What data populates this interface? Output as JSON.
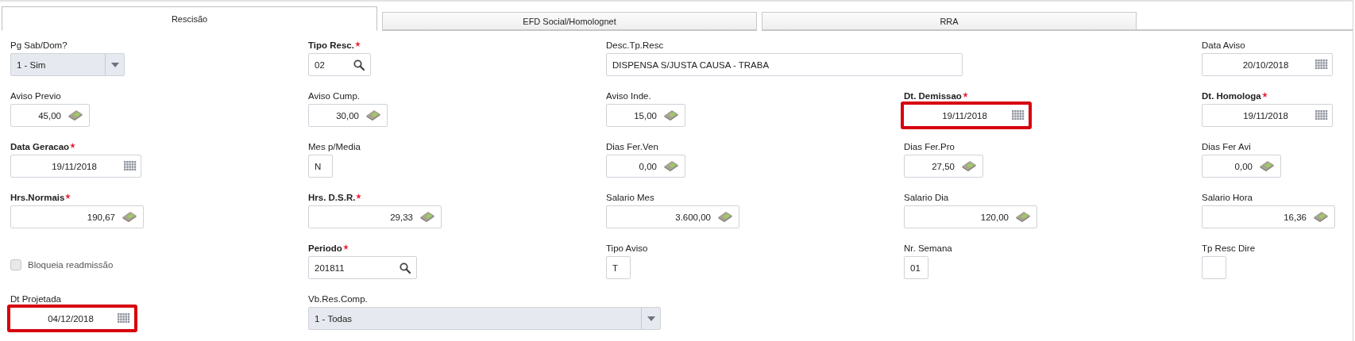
{
  "tabs": [
    {
      "label": "Rescisão",
      "selected": true
    },
    {
      "label": "EFD Social/Homolognet",
      "selected": false
    },
    {
      "label": "RRA",
      "selected": false
    }
  ],
  "rows": [
    [
      {
        "kind": "select",
        "label": "Pg Sab/Dom?",
        "required": false,
        "highlighted": false,
        "value": "1 - Sim"
      },
      {
        "kind": "lookup",
        "label": "Tipo Resc.",
        "required": true,
        "highlighted": false,
        "value": "02"
      },
      {
        "kind": "desc",
        "label": "Desc.Tp.Resc",
        "required": false,
        "highlighted": false,
        "value": "DISPENSA S/JUSTA CAUSA - TRABA"
      },
      {
        "kind": "date",
        "label": "Data Aviso",
        "required": false,
        "highlighted": false,
        "value": "20/10/2018"
      }
    ],
    [
      {
        "kind": "money",
        "label": "Aviso Previo",
        "required": false,
        "highlighted": false,
        "value": "45,00"
      },
      {
        "kind": "money",
        "label": "Aviso Cump.",
        "required": false,
        "highlighted": false,
        "value": "30,00"
      },
      {
        "kind": "money",
        "label": "Aviso Inde.",
        "required": false,
        "highlighted": false,
        "value": "15,00"
      },
      {
        "kind": "date",
        "label": "Dt. Demissao",
        "required": true,
        "highlighted": true,
        "value": "19/11/2018"
      },
      {
        "kind": "date",
        "label": "Dt. Homologa",
        "required": true,
        "highlighted": false,
        "value": "19/11/2018"
      }
    ],
    [
      {
        "kind": "date",
        "label": "Data Geracao",
        "required": true,
        "highlighted": false,
        "value": "19/11/2018"
      },
      {
        "kind": "char",
        "label": "Mes p/Media",
        "required": false,
        "highlighted": false,
        "value": "N"
      },
      {
        "kind": "money",
        "label": "Dias Fer.Ven",
        "required": false,
        "highlighted": false,
        "value": "0,00"
      },
      {
        "kind": "money",
        "label": "Dias Fer.Pro",
        "required": false,
        "highlighted": false,
        "value": "27,50"
      },
      {
        "kind": "money",
        "label": "Dias Fer Avi",
        "required": false,
        "highlighted": false,
        "value": "0,00"
      }
    ],
    [
      {
        "kind": "money",
        "label": "Hrs.Normais",
        "required": true,
        "highlighted": false,
        "value": "190,67"
      },
      {
        "kind": "money",
        "label": "Hrs. D.S.R.",
        "required": true,
        "highlighted": false,
        "value": "29,33"
      },
      {
        "kind": "money",
        "label": "Salario Mes",
        "required": false,
        "highlighted": false,
        "value": "3.600,00"
      },
      {
        "kind": "money",
        "label": "Salario Dia",
        "required": false,
        "highlighted": false,
        "value": "120,00"
      },
      {
        "kind": "money",
        "label": "Salario Hora",
        "required": false,
        "highlighted": false,
        "value": "16,36"
      }
    ],
    [
      {
        "kind": "checkbox",
        "label": "Bloqueia readmissão",
        "checked": false,
        "disabled": true
      },
      {
        "kind": "lookup",
        "label": "Periodo",
        "required": true,
        "highlighted": false,
        "value": "201811"
      },
      {
        "kind": "char",
        "label": "Tipo Aviso",
        "required": false,
        "highlighted": false,
        "value": "T"
      },
      {
        "kind": "char",
        "label": "Nr. Semana",
        "required": false,
        "highlighted": false,
        "value": "01"
      },
      {
        "kind": "char",
        "label": "Tp Resc Dire",
        "required": false,
        "highlighted": false
      }
    ],
    [
      {
        "kind": "date",
        "label": "Dt Projetada",
        "required": false,
        "highlighted": true,
        "value": "04/12/2018"
      },
      {
        "kind": "select",
        "label": "Vb.Res.Comp.",
        "required": false,
        "highlighted": false,
        "value": "1 - Todas"
      }
    ]
  ]
}
